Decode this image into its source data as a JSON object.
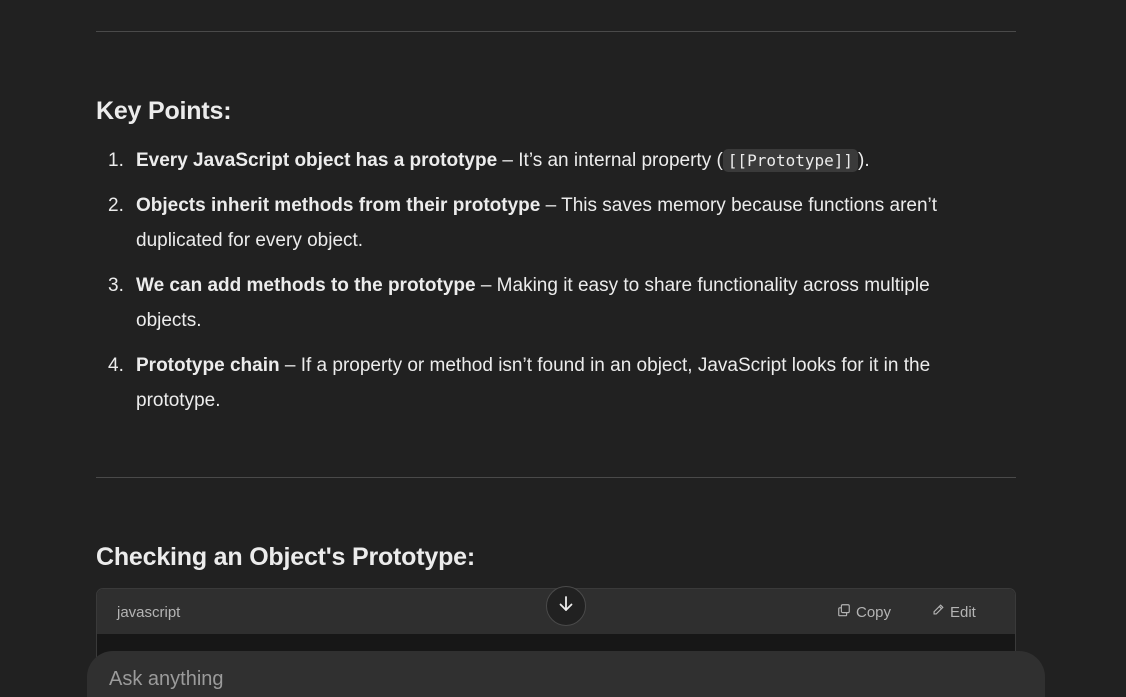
{
  "key_points": {
    "heading": "Key Points:",
    "items": [
      {
        "number": "1.",
        "bold": "Every JavaScript object has a prototype",
        "text_before_code": " – It’s an internal property (",
        "code": "[[Prototype]]",
        "text_after_code": ")."
      },
      {
        "number": "2.",
        "bold": "Objects inherit methods from their prototype",
        "text": " – This saves memory because functions aren’t duplicated for every object."
      },
      {
        "number": "3.",
        "bold": "We can add methods to the prototype",
        "text": " – Making it easy to share functionality across multiple objects."
      },
      {
        "number": "4.",
        "bold": "Prototype chain",
        "text": " – If a property or method isn’t found in an object, JavaScript looks for it in the prototype."
      }
    ]
  },
  "checking": {
    "heading": "Checking an Object's Prototype:"
  },
  "code_block": {
    "language": "javascript",
    "copy_label": "Copy",
    "edit_label": "Edit"
  },
  "composer": {
    "placeholder": "Ask anything"
  },
  "icons": {
    "copy": "copy-icon",
    "edit": "pencil-icon",
    "scroll": "arrow-down-icon"
  }
}
